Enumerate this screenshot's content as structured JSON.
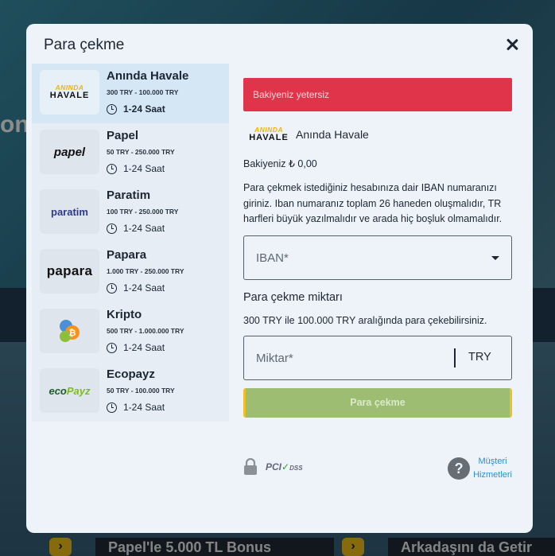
{
  "background": {
    "hero_text": "on",
    "cards": [
      {
        "title": "Papel'le 5.000 TL Bonus"
      },
      {
        "title": "Arkadaşını da Getir"
      }
    ]
  },
  "modal": {
    "title": "Para çekme",
    "close_icon": "close-icon"
  },
  "methods": [
    {
      "name": "Anında Havale",
      "range": "300 TRY - 100.000 TRY",
      "time": "1-24 Saat",
      "logo": {
        "line1": "ANINDA",
        "line2": "HAVALE"
      },
      "active": true
    },
    {
      "name": "Papel",
      "range": "50 TRY - 250.000 TRY",
      "time": "1-24 Saat",
      "logo": {
        "text": "papel"
      }
    },
    {
      "name": "Paratim",
      "range": "100 TRY - 250.000 TRY",
      "time": "1-24 Saat",
      "logo": {
        "text": "paratim"
      }
    },
    {
      "name": "Papara",
      "range": "1.000 TRY - 250.000 TRY",
      "time": "1-24 Saat",
      "logo": {
        "text": "papara"
      }
    },
    {
      "name": "Kripto",
      "range": "500 TRY - 1.000.000 TRY",
      "time": "1-24 Saat",
      "logo": {
        "text": "₿"
      }
    },
    {
      "name": "Ecopayz",
      "range": "50 TRY - 100.000 TRY",
      "time": "1-24 Saat",
      "logo": {
        "text_a": "eco",
        "text_b": "Payz"
      }
    }
  ],
  "panel": {
    "alert": "Bakiyeniz yetersiz",
    "selected_method": "Anında Havale",
    "selected_logo": {
      "line1": "ANINDA",
      "line2": "HAVALE"
    },
    "balance": "Bakiyeniz ₺ 0,00",
    "info": "Para çekmek istediğiniz hesabınıza dair IBAN numaranızı giriniz. Iban numaranız toplam 26 haneden oluşmalıdır, TR harfleri büyük yazılmalıdır ve arada hiç boşluk olmamalıdır.",
    "iban_placeholder": "IBAN*",
    "amount_title": "Para çekme miktarı",
    "amount_note": "300 TRY ile 100.000 TRY aralığında para çekebilirsiniz.",
    "amount_placeholder": "Miktar*",
    "currency": "TRY",
    "submit_label": "Para çekme"
  },
  "footer": {
    "pci_a": "PCI",
    "pci_b": "DSS",
    "help_line1": "Müşteri",
    "help_line2": "Hizmetleri"
  },
  "colors": {
    "alert": "#e0344a",
    "submit": "#9dbd73",
    "link": "#2b8fd0"
  }
}
